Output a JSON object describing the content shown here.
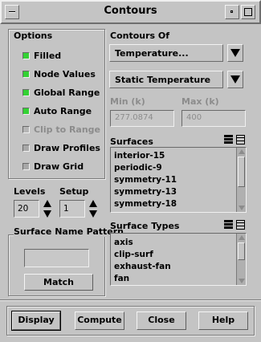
{
  "window": {
    "title": "Contours"
  },
  "options": {
    "heading": "Options",
    "items": [
      {
        "label": "Filled",
        "checked": true,
        "enabled": true
      },
      {
        "label": "Node Values",
        "checked": true,
        "enabled": true
      },
      {
        "label": "Global Range",
        "checked": true,
        "enabled": true
      },
      {
        "label": "Auto Range",
        "checked": true,
        "enabled": true
      },
      {
        "label": "Clip to Range",
        "checked": false,
        "enabled": false
      },
      {
        "label": "Draw Profiles",
        "checked": false,
        "enabled": true
      },
      {
        "label": "Draw Grid",
        "checked": false,
        "enabled": true
      }
    ]
  },
  "levels": {
    "label": "Levels",
    "value": "20"
  },
  "setup": {
    "label": "Setup",
    "value": "1"
  },
  "surface_name_pattern": {
    "label": "Surface Name Pattern",
    "value": "",
    "match_label": "Match"
  },
  "contours_of": {
    "label": "Contours Of",
    "category": "Temperature...",
    "quantity": "Static Temperature"
  },
  "range": {
    "min_label": "Min (k)",
    "min_value": "277.0874",
    "max_label": "Max (k)",
    "max_value": "400"
  },
  "surfaces": {
    "label": "Surfaces",
    "items": [
      "interior-15",
      "periodic-9",
      "symmetry-11",
      "symmetry-13",
      "symmetry-18"
    ]
  },
  "surface_types": {
    "label": "Surface Types",
    "items": [
      "axis",
      "clip-surf",
      "exhaust-fan",
      "fan"
    ]
  },
  "buttons": {
    "display": "Display",
    "compute": "Compute",
    "close": "Close",
    "help": "Help"
  },
  "colors": {
    "background": "#c4c4c4",
    "checked": "#33d133"
  }
}
